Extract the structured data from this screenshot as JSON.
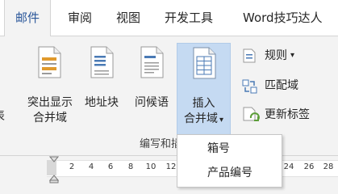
{
  "tabs": [
    {
      "label": "邮件",
      "active": true
    },
    {
      "label": "审阅",
      "active": false
    },
    {
      "label": "视图",
      "active": false
    },
    {
      "label": "开发工具",
      "active": false
    },
    {
      "label": "Word技巧达人",
      "active": false
    }
  ],
  "ribbon": {
    "left_clip_label": "表",
    "buttons": {
      "highlight": {
        "line1": "突出显示",
        "line2": "合并域"
      },
      "address": {
        "line1": "地址块"
      },
      "greeting": {
        "line1": "问候语"
      },
      "insert": {
        "line1": "插入",
        "line2": "合并域",
        "arrow": "▾"
      }
    },
    "small_buttons": {
      "rules": {
        "label": "规则",
        "arrow": "▾"
      },
      "match": {
        "label": "匹配域"
      },
      "update": {
        "label": "更新标签"
      }
    },
    "group_label": "编写和插"
  },
  "ruler": {
    "ticks": [
      "2",
      "4",
      "6",
      "8",
      "10",
      "12",
      "24",
      "26",
      "28",
      "30"
    ]
  },
  "dropdown": {
    "items": [
      "箱号",
      "产品编号"
    ]
  },
  "colors": {
    "accent": "#2b579a",
    "selected": "#c5daf2",
    "icon_blue": "#4a7ab5",
    "icon_green": "#5d9e3a",
    "icon_orange": "#e09a2d"
  }
}
